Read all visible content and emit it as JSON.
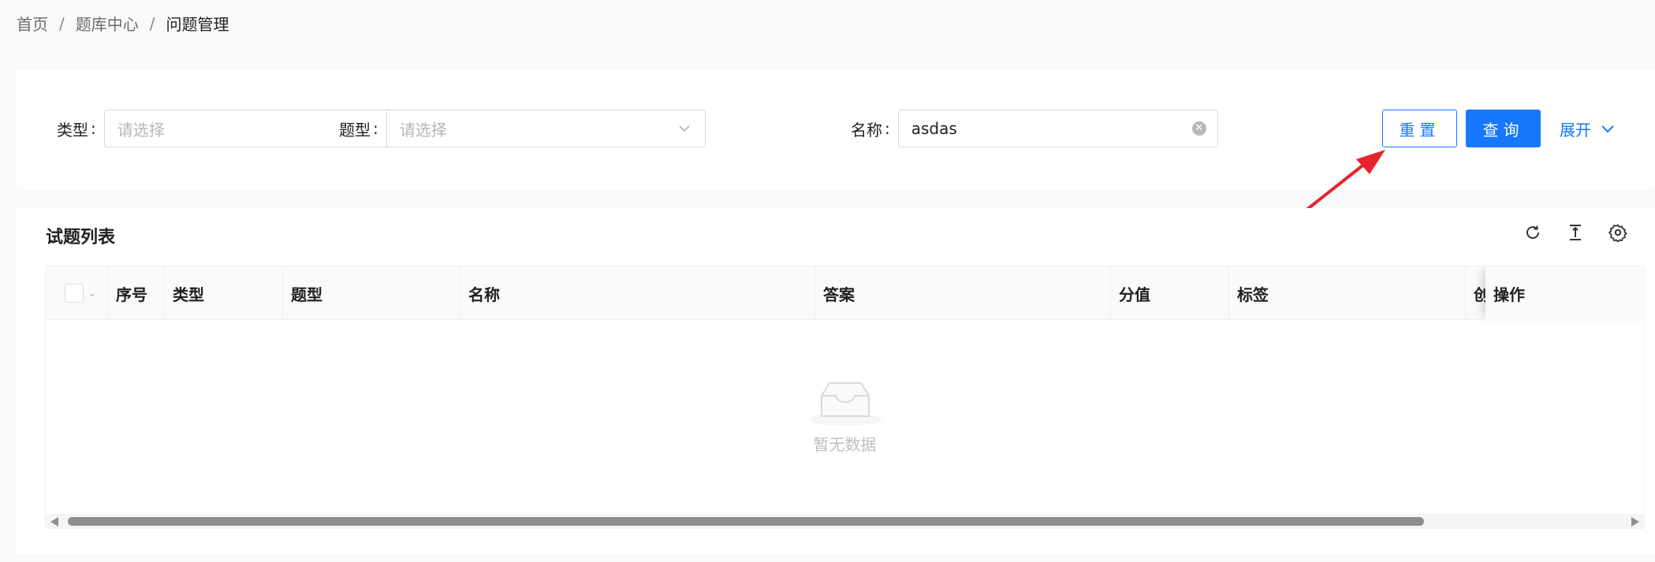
{
  "breadcrumb": {
    "items": [
      "首页",
      "题库中心",
      "问题管理"
    ],
    "separator": "/"
  },
  "filters": {
    "type": {
      "label": "类型",
      "colon": ":",
      "placeholder": "请选择"
    },
    "question_type": {
      "label": "题型",
      "colon": ":",
      "placeholder": "请选择"
    },
    "name": {
      "label": "名称",
      "colon": ":",
      "value": "asdas"
    },
    "reset_label": "重置",
    "query_label": "查询",
    "expand_label": "展开"
  },
  "table": {
    "title": "试题列表",
    "columns": [
      "序号",
      "类型",
      "题型",
      "名称",
      "答案",
      "分值",
      "标签",
      "创",
      "操作"
    ],
    "empty_text": "暂无数据"
  },
  "icons": {
    "refresh": "refresh-icon",
    "density": "column-height-icon",
    "settings": "gear-icon"
  },
  "colors": {
    "primary": "#1677ff",
    "annotation_arrow": "#e8232e"
  }
}
